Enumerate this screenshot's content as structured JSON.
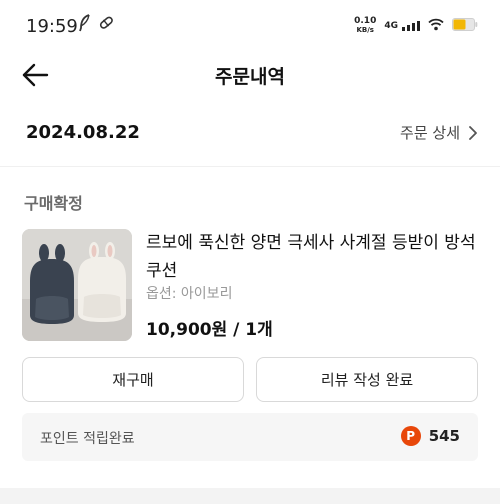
{
  "status_bar": {
    "time": "19:59",
    "net_speed_value": "0.10",
    "net_speed_unit": "KB/s",
    "network_type": "4G",
    "battery_color": "#f2b705"
  },
  "header": {
    "title": "주문내역",
    "back_icon": "arrow-left-icon"
  },
  "order": {
    "date": "2024.08.22",
    "detail_link_label": "주문 상세",
    "status": "구매확정",
    "product": {
      "name": "르보에 푹신한 양면 극세사 사계절 등받이 방석 쿠션",
      "option": "옵션: 아이보리",
      "price_qty": "10,900원 / 1개"
    },
    "actions": {
      "rebuy_label": "재구매",
      "review_label": "리뷰 작성 완료"
    },
    "points": {
      "label": "포인트 적립완료",
      "icon_letter": "P",
      "value": "545",
      "icon_color": "#e8470a"
    }
  }
}
